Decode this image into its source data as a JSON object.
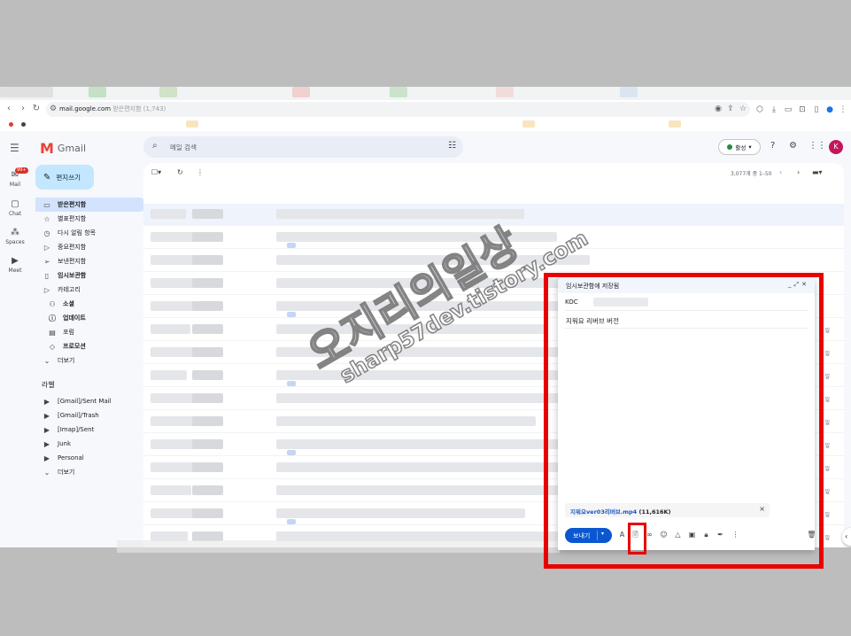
{
  "browser": {
    "url_host": "mail.google.com",
    "url_path": "받은편지함 (1,743)"
  },
  "app": {
    "name": "Gmail",
    "search_placeholder": "메일 검색",
    "status": "활성",
    "avatar_letter": "K",
    "compose_label": "편지쓰기"
  },
  "rail": [
    {
      "label": "Mail",
      "icon": "mail-icon",
      "badge": "99+"
    },
    {
      "label": "Chat",
      "icon": "chat-icon"
    },
    {
      "label": "Spaces",
      "icon": "spaces-icon"
    },
    {
      "label": "Meet",
      "icon": "meet-icon"
    }
  ],
  "nav": [
    {
      "label": "받은편지함",
      "icon": "inbox-icon",
      "active": true
    },
    {
      "label": "별표편지함",
      "icon": "star-icon"
    },
    {
      "label": "다시 알림 항목",
      "icon": "clock-icon"
    },
    {
      "label": "중요편지함",
      "icon": "important-icon"
    },
    {
      "label": "보낸편지함",
      "icon": "send-icon"
    },
    {
      "label": "임시보관함",
      "icon": "draft-icon",
      "bold": true
    },
    {
      "label": "카테고리",
      "icon": "label-outline-icon"
    },
    {
      "label": "소셜",
      "icon": "people-icon",
      "bold": true,
      "indent": true
    },
    {
      "label": "업데이트",
      "icon": "info-icon",
      "bold": true,
      "indent": true
    },
    {
      "label": "포럼",
      "icon": "forum-icon",
      "indent": true
    },
    {
      "label": "프로모션",
      "icon": "tag-icon",
      "bold": true,
      "indent": true
    },
    {
      "label": "더보기",
      "icon": "chevron-down-icon"
    }
  ],
  "labels_heading": "라벨",
  "labels": [
    {
      "label": "[Gmail]/Sent Mail"
    },
    {
      "label": "[Gmail]/Trash"
    },
    {
      "label": "[Imap]/Sent"
    },
    {
      "label": "Junk"
    },
    {
      "label": "Personal"
    },
    {
      "label": "더보기"
    }
  ],
  "list": {
    "page_info": "3,077개 중 1–50",
    "row_dates": [
      "",
      "",
      "",
      "",
      "",
      "일",
      "일",
      "일",
      "일",
      "일",
      "일",
      "일",
      "일",
      "일",
      "일"
    ]
  },
  "compose_window": {
    "title": "임시보관함에 저장됨",
    "to_prefix": "KOC",
    "subject": "지워요 리버브 버전",
    "attachment_name": "지워요ver03리버브.mp4",
    "attachment_size": "(11,616K)",
    "send_label": "보내기"
  },
  "watermark": {
    "title": "오지리의일상",
    "subtitle": "sharp57dev.tistory.com"
  },
  "colors": {
    "highlight_red": "#e90000",
    "compose_blue": "#c2e7ff",
    "send_blue": "#0b57d0",
    "active_nav": "#d3e3fd"
  }
}
